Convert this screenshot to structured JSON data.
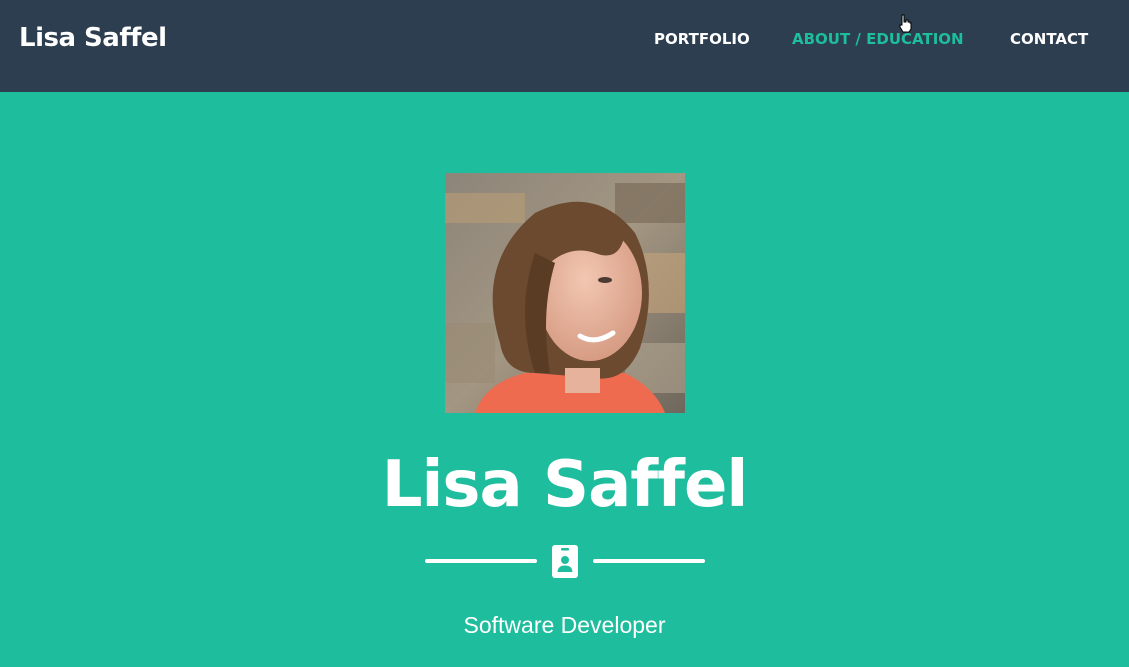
{
  "navbar": {
    "brand": "Lisa Saffel",
    "links": [
      {
        "label": "PORTFOLIO",
        "active": false
      },
      {
        "label": "ABOUT / EDUCATION",
        "active": true
      },
      {
        "label": "CONTACT",
        "active": false
      }
    ]
  },
  "masthead": {
    "avatar_icon": "profile-photo",
    "heading": "Lisa Saffel",
    "divider_icon": "id-badge-icon",
    "subheading": "Software Developer"
  },
  "colors": {
    "navbar_bg": "#2c3e50",
    "accent": "#1ebd9d",
    "text": "#ffffff"
  }
}
